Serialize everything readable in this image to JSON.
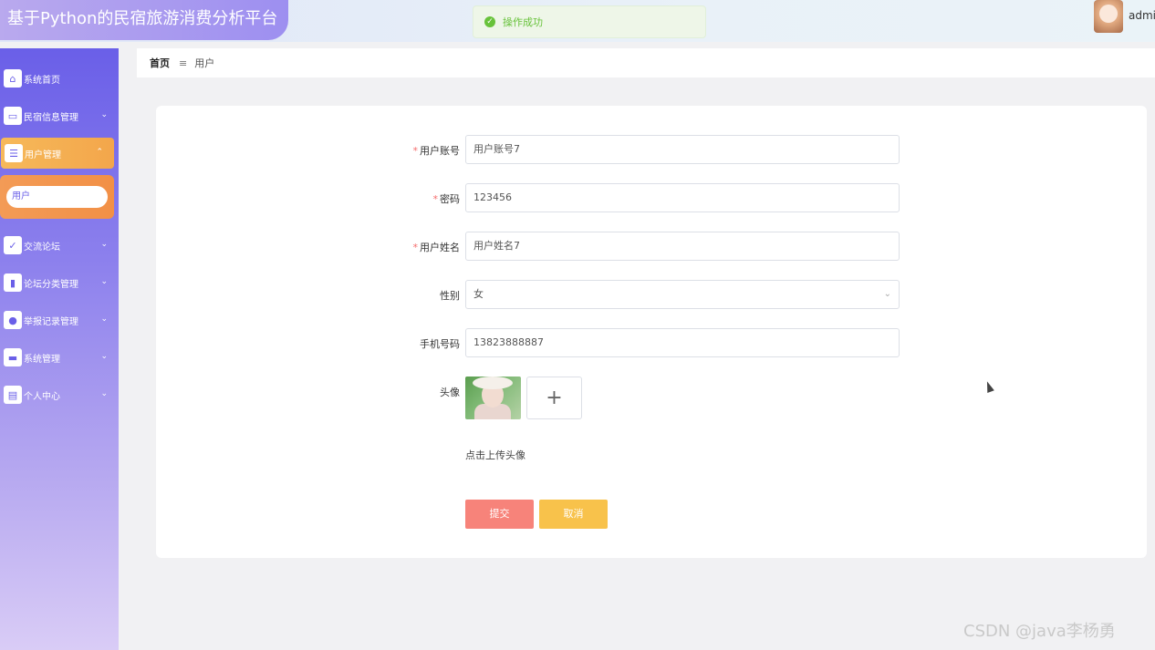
{
  "header": {
    "title": "基于Python的民宿旅游消费分析平台",
    "toast": "操作成功",
    "username": "admin"
  },
  "sidebar": {
    "items": [
      {
        "label": "系统首页",
        "icon": "home-icon"
      },
      {
        "label": "民宿信息管理",
        "icon": "monitor-icon"
      },
      {
        "label": "用户管理",
        "icon": "sliders-icon"
      },
      {
        "label": "交流论坛",
        "icon": "clipboard-icon"
      },
      {
        "label": "论坛分类管理",
        "icon": "book-icon"
      },
      {
        "label": "举报记录管理",
        "icon": "balloon-icon"
      },
      {
        "label": "系统管理",
        "icon": "briefcase-icon"
      },
      {
        "label": "个人中心",
        "icon": "wallet-icon"
      }
    ],
    "submenu": {
      "label": "用户"
    }
  },
  "breadcrumb": {
    "home": "首页",
    "separator": "≡",
    "current": "用户"
  },
  "form": {
    "account": {
      "label": "用户账号",
      "value": "用户账号7",
      "required": true
    },
    "password": {
      "label": "密码",
      "value": "123456",
      "required": true
    },
    "name": {
      "label": "用户姓名",
      "value": "用户姓名7",
      "required": true
    },
    "gender": {
      "label": "性别",
      "value": "女"
    },
    "phone": {
      "label": "手机号码",
      "value": "13823888887"
    },
    "avatar": {
      "label": "头像",
      "hint": "点击上传头像"
    },
    "submit_label": "提交",
    "cancel_label": "取消"
  },
  "watermark": "CSDN @java李杨勇"
}
